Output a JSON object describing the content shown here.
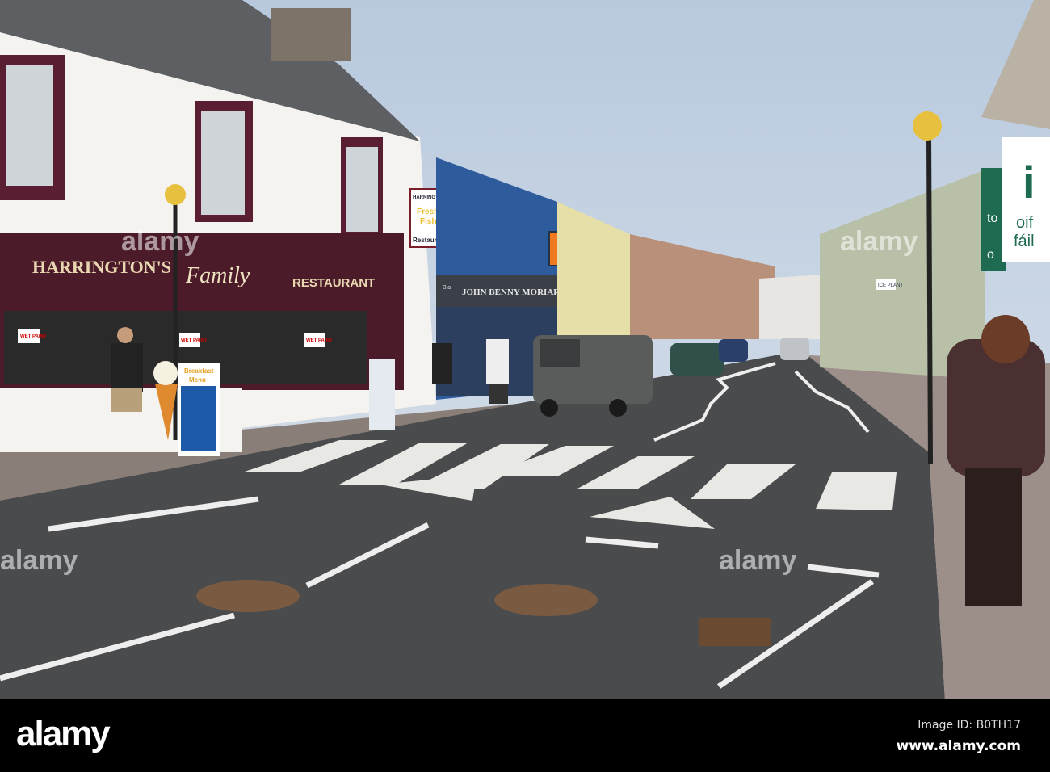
{
  "photo": {
    "main_sign": {
      "name": "HARRINGTON'S",
      "family": "Family",
      "restaurant": "RESTAURANT"
    },
    "hanging_sign": {
      "line1": "HARRINGTON'S",
      "line2": "Fresh",
      "line3": "Fish",
      "line4": "Restaurant"
    },
    "pub_sign": {
      "irish": "Bia",
      "name": "JOHN BENNY MORIARTY"
    },
    "wet_paint": "WET PAINT",
    "menu_board": {
      "line1": "Breakfast",
      "line2": "Menu"
    },
    "ice_plant": "ICE PLANT",
    "tourist_sign": {
      "letter": "i",
      "line1": "oif",
      "line2": "fáil",
      "left1": "to",
      "left2": "o"
    },
    "watermark": "alamy"
  },
  "footer": {
    "logo": "alamy",
    "image_id": "Image ID: B0TH17",
    "url": "www.alamy.com"
  }
}
